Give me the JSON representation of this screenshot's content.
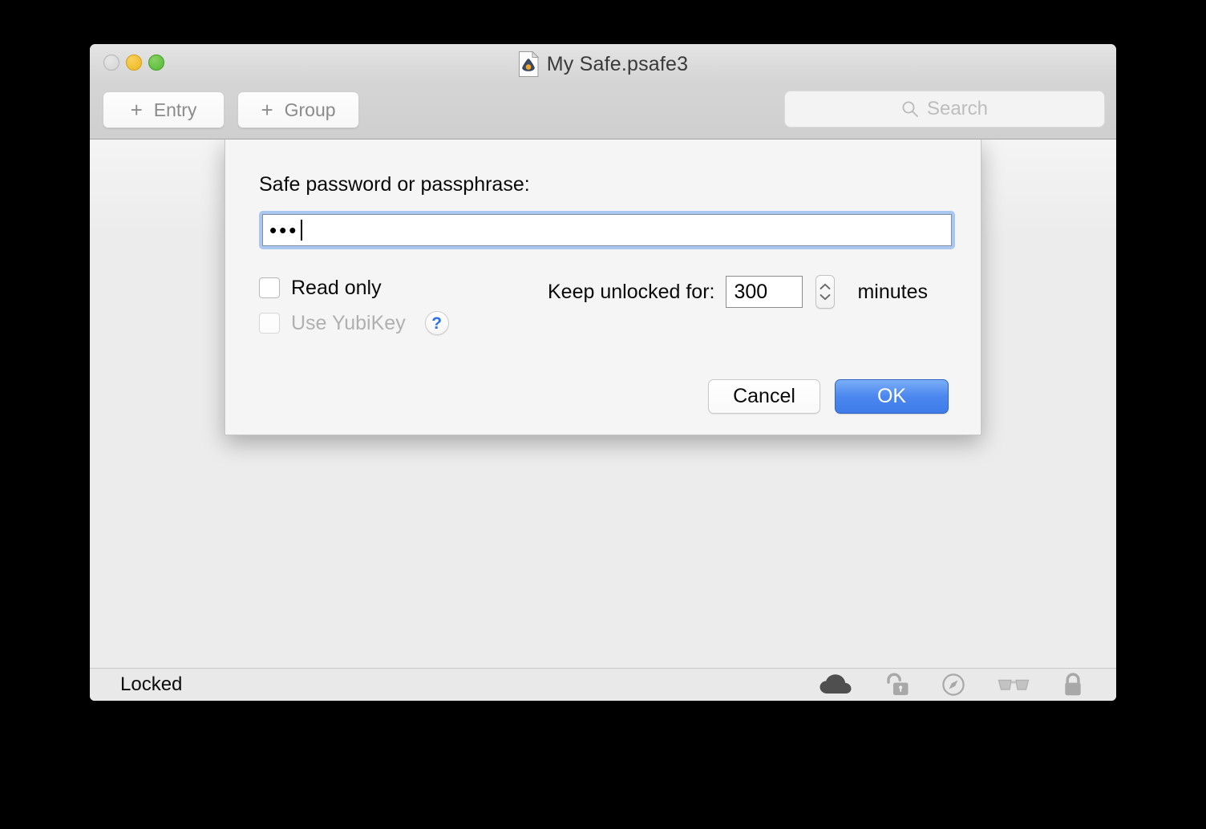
{
  "window": {
    "title": "My Safe.psafe3",
    "title_icon": "psafe-document-icon",
    "traffic_lights": [
      {
        "name": "close-button",
        "color": "#d6d6d6"
      },
      {
        "name": "minimize-button",
        "color": "#eeb71d"
      },
      {
        "name": "maximize-button",
        "color": "#64c341"
      }
    ]
  },
  "toolbar": {
    "entry_button": {
      "label": "Entry",
      "icon": "plus-icon"
    },
    "group_button": {
      "label": "Group",
      "icon": "plus-icon"
    },
    "search": {
      "placeholder": "Search",
      "value": "",
      "icon": "search-icon"
    }
  },
  "content": {
    "watermark_icon": "password-safe-logo-watermark"
  },
  "sheet": {
    "password_label": "Safe password or passphrase:",
    "password_value": "•••",
    "password_masked_length": 3,
    "read_only": {
      "label": "Read only",
      "checked": false,
      "disabled": false
    },
    "use_yubikey": {
      "label": "Use YubiKey",
      "checked": false,
      "disabled": true
    },
    "help_button": {
      "label": "?",
      "icon": "question-mark-icon"
    },
    "keep_unlocked": {
      "label": "Keep unlocked for:",
      "value": "300",
      "units": "minutes",
      "stepper_icon": "stepper-up-down-icon"
    },
    "cancel_button": "Cancel",
    "ok_button": "OK"
  },
  "statusbar": {
    "status": "Locked",
    "icons": [
      {
        "name": "cloud-icon",
        "color": "#4f4f4f"
      },
      {
        "name": "unlocked-padlock-icon",
        "color": "#a8a8a8"
      },
      {
        "name": "compass-icon",
        "color": "#a8a8a8"
      },
      {
        "name": "glasses-icon",
        "color": "#bdbdbd"
      },
      {
        "name": "locked-padlock-icon",
        "color": "#a8a8a8"
      }
    ]
  },
  "colors": {
    "accent_blue": "#4b87ee",
    "focus_ring": "#a9c7ef",
    "help_blue": "#2e6ff0",
    "window_chrome": "#d5d5d5",
    "sheet_bg": "#f5f5f5",
    "content_bg": "#ececec",
    "statusbar_bg": "#e9e9e9"
  }
}
